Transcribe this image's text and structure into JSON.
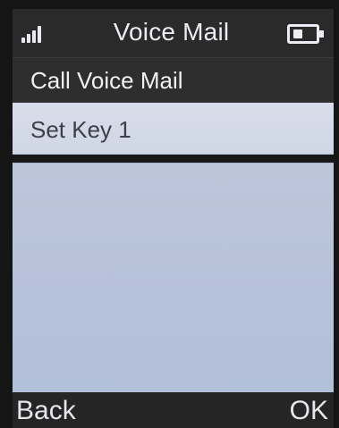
{
  "header": {
    "title": "Voice Mail",
    "signal_icon": "signal-strength-icon",
    "battery_icon": "battery-icon"
  },
  "menu": {
    "items": [
      {
        "label": "Call Voice Mail",
        "selected": false
      },
      {
        "label": "Set Key 1",
        "selected": true
      }
    ]
  },
  "softkeys": {
    "left": "Back",
    "right": "OK"
  },
  "colors": {
    "status_bar": "#2a2a2a",
    "selected_item": "#d8dde9",
    "screen_background": "#b8c3da",
    "text_light": "#ececf2",
    "text_dark": "#3e4048"
  }
}
